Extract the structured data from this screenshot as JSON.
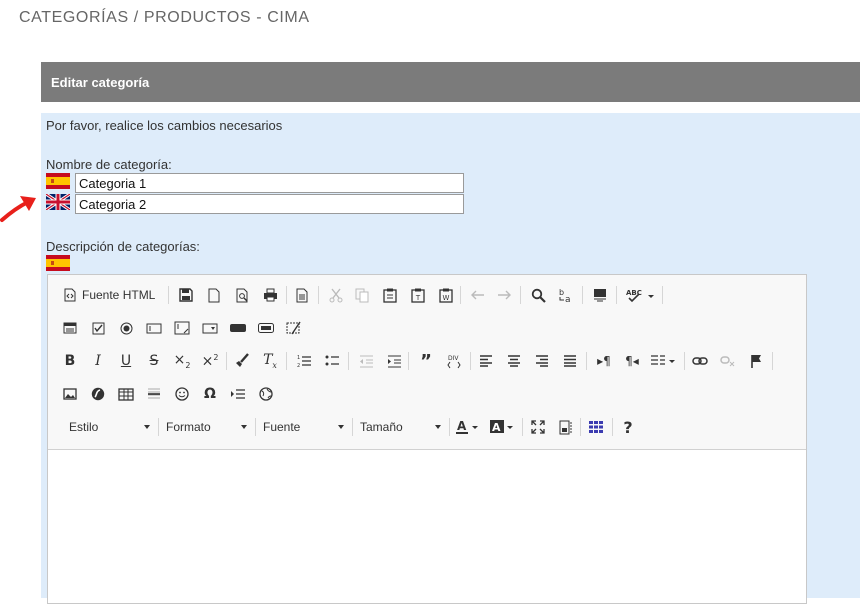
{
  "page": {
    "title": "CATEGORÍAS / PRODUCTOS - CIMA"
  },
  "panel": {
    "header": "Editar categoría",
    "instructions": "Por favor, realice los cambios necesarios",
    "name_label": "Nombre de categoría:",
    "name_es": "Categoria 1",
    "name_en": "Categoria 2",
    "desc_label": "Descripción de categorías:"
  },
  "editor": {
    "source_label": "Fuente HTML",
    "combos": {
      "style": "Estilo",
      "format": "Formato",
      "font": "Fuente",
      "size": "Tamaño"
    }
  },
  "colors": {
    "header_bg": "#7b7b7b",
    "panel_bg": "#deecfa",
    "arrow": "#e8201b"
  }
}
